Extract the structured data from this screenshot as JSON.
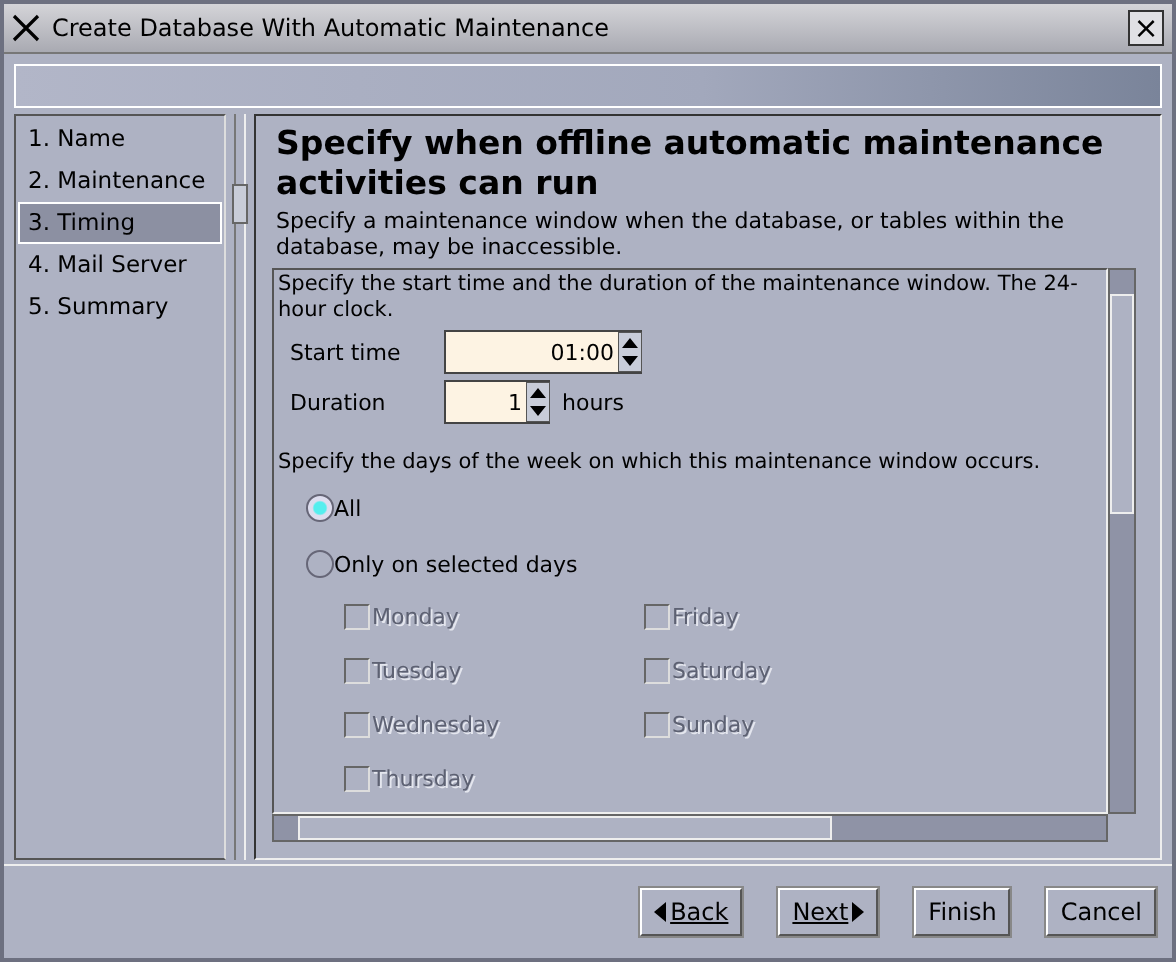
{
  "window": {
    "title": "Create Database With Automatic Maintenance",
    "close": "×"
  },
  "steps": [
    {
      "number": "1.",
      "label": "Name",
      "selected": false
    },
    {
      "number": "2.",
      "label": "Maintenance",
      "selected": false
    },
    {
      "number": "3.",
      "label": "Timing",
      "selected": true
    },
    {
      "number": "4.",
      "label": "Mail Server",
      "selected": false
    },
    {
      "number": "5.",
      "label": "Summary",
      "selected": false
    }
  ],
  "heading": "Specify when offline automatic maintenance activities can run",
  "description": "Specify a maintenance window when the database, or tables within the database, may be inaccessible.",
  "panel": {
    "intro": "Specify the start time and the duration of the maintenance window. The 24-hour clock.",
    "fields": [
      {
        "label": "Start time",
        "value": "01:00"
      },
      {
        "label": "Duration",
        "value": "1",
        "unit": "hours"
      }
    ],
    "days_prompt": "Specify the days of the week on which this maintenance window occurs.",
    "options": [
      {
        "label": "All",
        "selected": true
      },
      {
        "label": "Only on selected days",
        "selected": false
      }
    ],
    "days": [
      {
        "label": "Monday",
        "checked": false,
        "disabled": true
      },
      {
        "label": "Tuesday",
        "checked": false,
        "disabled": true
      },
      {
        "label": "Wednesday",
        "checked": false,
        "disabled": true
      },
      {
        "label": "Thursday",
        "checked": false,
        "disabled": true
      },
      {
        "label": "Friday",
        "checked": false,
        "disabled": true
      },
      {
        "label": "Saturday",
        "checked": false,
        "disabled": true
      },
      {
        "label": "Sunday",
        "checked": false,
        "disabled": true
      }
    ]
  },
  "buttons": [
    {
      "label": "Back",
      "kind": "back"
    },
    {
      "label": "Next",
      "kind": "next"
    },
    {
      "label": "Finish",
      "kind": "plain"
    },
    {
      "label": "Cancel",
      "kind": "plain"
    }
  ]
}
